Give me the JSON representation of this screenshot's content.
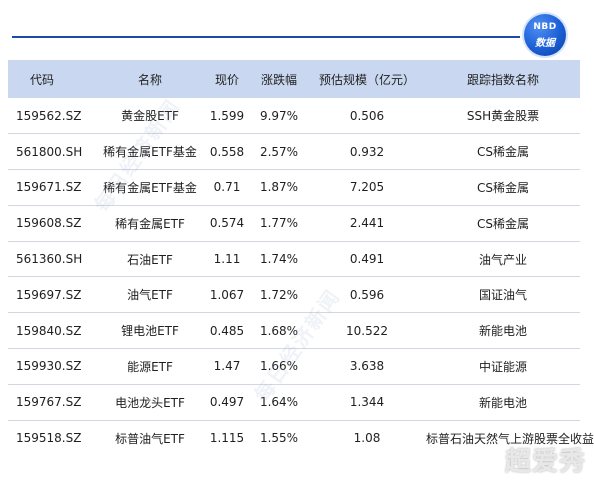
{
  "brand": {
    "logo_line1": "NBD",
    "logo_line2": "数据",
    "watermark_text": "每日经济新闻",
    "corner_mark": "超爱秀"
  },
  "colors": {
    "accent": "#1b4aa8",
    "header_bg": "#c9d8f0",
    "row_divider": "#d3d8e0"
  },
  "table": {
    "headers": [
      "代码",
      "名称",
      "现价",
      "涨跌幅",
      "预估规模（亿元）",
      "跟踪指数名称"
    ],
    "rows": [
      [
        "159562.SZ",
        "黄金股ETF",
        "1.599",
        "9.97%",
        "0.506",
        "SSH黄金股票"
      ],
      [
        "561800.SH",
        "稀有金属ETF基金",
        "0.558",
        "2.57%",
        "0.932",
        "CS稀金属"
      ],
      [
        "159671.SZ",
        "稀有金属ETF基金",
        "0.71",
        "1.87%",
        "7.205",
        "CS稀金属"
      ],
      [
        "159608.SZ",
        "稀有金属ETF",
        "0.574",
        "1.77%",
        "2.441",
        "CS稀金属"
      ],
      [
        "561360.SH",
        "石油ETF",
        "1.11",
        "1.74%",
        "0.491",
        "油气产业"
      ],
      [
        "159697.SZ",
        "油气ETF",
        "1.067",
        "1.72%",
        "0.596",
        "国证油气"
      ],
      [
        "159840.SZ",
        "锂电池ETF",
        "0.485",
        "1.68%",
        "10.522",
        "新能电池"
      ],
      [
        "159930.SZ",
        "能源ETF",
        "1.47",
        "1.66%",
        "3.638",
        "中证能源"
      ],
      [
        "159767.SZ",
        "电池龙头ETF",
        "0.497",
        "1.64%",
        "1.344",
        "新能电池"
      ],
      [
        "159518.SZ",
        "标普油气ETF",
        "1.115",
        "1.55%",
        "1.08",
        "标普石油天然气上游股票全收益指数"
      ]
    ]
  }
}
